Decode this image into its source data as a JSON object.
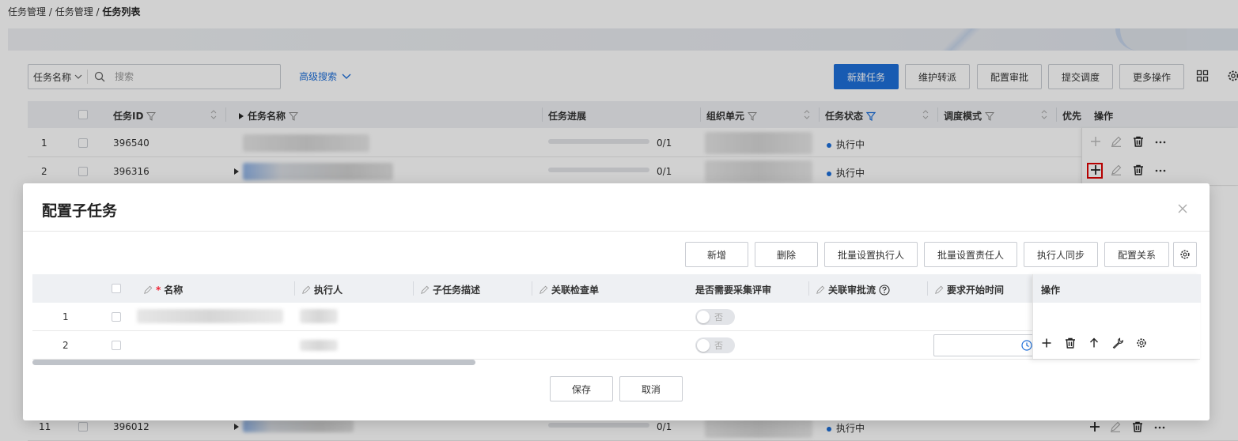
{
  "breadcrumb": {
    "items": [
      "任务管理",
      "任务管理"
    ],
    "current": "任务列表",
    "sep": " / "
  },
  "search": {
    "field_label": "任务名称",
    "placeholder": "搜索",
    "advanced_label": "高级搜索"
  },
  "toolbar": {
    "new_task": "新建任务",
    "maintain_transfer": "维护转派",
    "config_approval": "配置审批",
    "submit_dispatch": "提交调度",
    "more_actions": "更多操作"
  },
  "grid": {
    "columns": {
      "task_id": "任务ID",
      "task_name": "任务名称",
      "progress": "任务进展",
      "org_unit": "组织单元",
      "status": "任务状态",
      "dispatch_mode": "调度模式",
      "priority": "优先",
      "ops": "操作"
    },
    "rows": [
      {
        "index": "1",
        "id": "396540",
        "progress_text": "0/1",
        "progress": 0,
        "status": "执行中"
      },
      {
        "index": "2",
        "id": "396316",
        "progress_text": "0/1",
        "progress": 0,
        "status": "执行中"
      },
      {
        "index": "11",
        "id": "396012",
        "progress_text": "0/1",
        "progress": 0,
        "status": "执行中"
      }
    ]
  },
  "modal": {
    "title": "配置子任务",
    "buttons": {
      "add": "新增",
      "delete": "删除",
      "batch_executor": "批量设置执行人",
      "batch_owner": "批量设置责任人",
      "executor_sync": "执行人同步",
      "config_relation": "配置关系"
    },
    "columns": {
      "name": "名称",
      "required_mark": "*",
      "executor": "执行人",
      "desc": "子任务描述",
      "checklist": "关联检查单",
      "need_review": "是否需要采集评审",
      "approval_flow": "关联审批流",
      "start_time": "要求开始时间",
      "ops": "操作"
    },
    "rows": [
      {
        "index": "1",
        "need_review": "否"
      },
      {
        "index": "2",
        "need_review": "否"
      }
    ],
    "footer": {
      "save": "保存",
      "cancel": "取消"
    }
  },
  "colors": {
    "primary": "#1e6fd9",
    "highlight": "#e00000"
  }
}
